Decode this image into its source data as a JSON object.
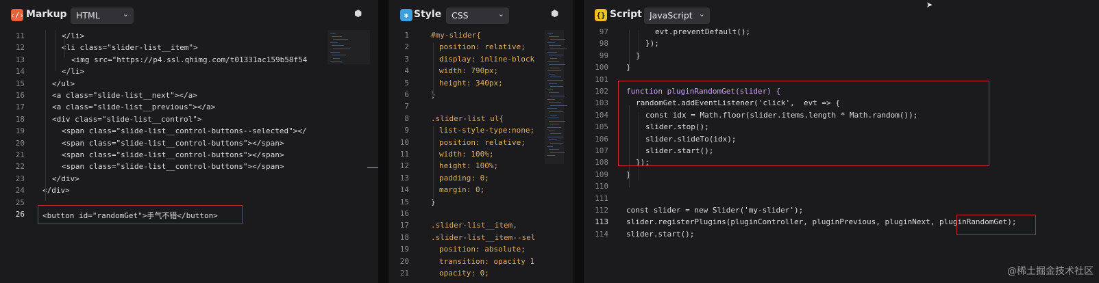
{
  "markup": {
    "title": "Markup",
    "language": "HTML",
    "lines": [
      {
        "n": "11",
        "t": "</li>"
      },
      {
        "n": "12",
        "t": "<li class=\"slider-list__item\">"
      },
      {
        "n": "13",
        "t": "<img src=\"https://p4.ssl.qhimg.com/t01331ac159b58f54"
      },
      {
        "n": "14",
        "t": "</li>"
      },
      {
        "n": "15",
        "t": "</ul>"
      },
      {
        "n": "16",
        "t": "<a class=\"slide-list__next\"></a>"
      },
      {
        "n": "17",
        "t": "<a class=\"slide-list__previous\"></a>"
      },
      {
        "n": "18",
        "t": "<div class=\"slide-list__control\">"
      },
      {
        "n": "19",
        "t": "<span class=\"slide-list__control-buttons--selected\"></"
      },
      {
        "n": "20",
        "t": "<span class=\"slide-list__control-buttons\"></span>"
      },
      {
        "n": "21",
        "t": "<span class=\"slide-list__control-buttons\"></span>"
      },
      {
        "n": "22",
        "t": "<span class=\"slide-list__control-buttons\"></span>"
      },
      {
        "n": "23",
        "t": "</div>"
      },
      {
        "n": "24",
        "t": "</div>"
      },
      {
        "n": "25",
        "t": ""
      },
      {
        "n": "26",
        "t": "<button id=\"randomGet\">手气不错</button>"
      }
    ]
  },
  "style": {
    "title": "Style",
    "language": "CSS",
    "lines": [
      {
        "n": "1",
        "t": "#my-slider{"
      },
      {
        "n": "2",
        "t": "position: relative;"
      },
      {
        "n": "3",
        "t": "display: inline-block"
      },
      {
        "n": "4",
        "t": "width: 790px;"
      },
      {
        "n": "5",
        "t": "height: 340px;"
      },
      {
        "n": "6",
        "t": "}"
      },
      {
        "n": "7",
        "t": ""
      },
      {
        "n": "8",
        "t": ".slider-list ul{"
      },
      {
        "n": "9",
        "t": "list-style-type:none;"
      },
      {
        "n": "10",
        "t": "position: relative;"
      },
      {
        "n": "11",
        "t": "width: 100%;"
      },
      {
        "n": "12",
        "t": "height: 100%;"
      },
      {
        "n": "13",
        "t": "padding: 0;"
      },
      {
        "n": "14",
        "t": "margin: 0;"
      },
      {
        "n": "15",
        "t": "}"
      },
      {
        "n": "16",
        "t": ""
      },
      {
        "n": "17",
        "t": ".slider-list__item,"
      },
      {
        "n": "18",
        "t": ".slider-list__item--sel"
      },
      {
        "n": "19",
        "t": "position: absolute;"
      },
      {
        "n": "20",
        "t": "transition: opacity 1"
      },
      {
        "n": "21",
        "t": "opacity: 0;"
      }
    ]
  },
  "script": {
    "title": "Script",
    "language": "JavaScript",
    "lines": [
      {
        "n": "97",
        "t": "evt.preventDefault();"
      },
      {
        "n": "98",
        "t": "});"
      },
      {
        "n": "99",
        "t": "}"
      },
      {
        "n": "100",
        "t": "}"
      },
      {
        "n": "101",
        "t": ""
      },
      {
        "n": "102",
        "t": "function pluginRandomGet(slider) {"
      },
      {
        "n": "103",
        "t": "randomGet.addEventListener('click',  evt => {"
      },
      {
        "n": "104",
        "t": "const idx = Math.floor(slider.items.length * Math.random());"
      },
      {
        "n": "105",
        "t": "slider.stop();"
      },
      {
        "n": "106",
        "t": "slider.slideTo(idx);"
      },
      {
        "n": "107",
        "t": "slider.start();"
      },
      {
        "n": "108",
        "t": "});"
      },
      {
        "n": "109",
        "t": "}"
      },
      {
        "n": "110",
        "t": ""
      },
      {
        "n": "111",
        "t": ""
      },
      {
        "n": "112",
        "t": "const slider = new Slider('my-slider');"
      },
      {
        "n": "113",
        "t": "slider.registerPlugins(pluginController, pluginPrevious, pluginNext, pluginRandomGet);"
      },
      {
        "n": "114",
        "t": "slider.start();"
      }
    ]
  },
  "watermark": "@稀土掘金技术社区",
  "colors": {
    "highlight_box": "#c8273a",
    "markup_icon": "#e8623a",
    "style_icon": "#3aa0e0",
    "script_icon": "#f0c020"
  },
  "icons": {
    "markup": "html-icon",
    "style": "css-icon",
    "script": "js-icon",
    "settings": "gear-icon",
    "dropdown": "chevron-down-icon",
    "cursor": "mouse-pointer-icon"
  }
}
